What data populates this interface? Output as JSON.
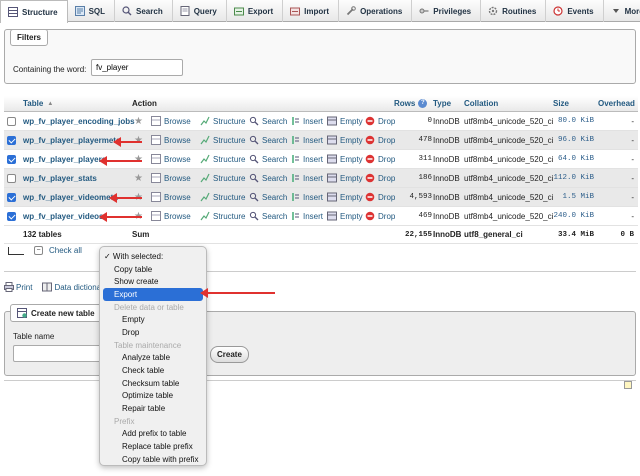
{
  "tabs": [
    {
      "label": "Structure",
      "icon": "structure-icon",
      "active": true
    },
    {
      "label": "SQL",
      "icon": "sql-icon"
    },
    {
      "label": "Search",
      "icon": "search-icon"
    },
    {
      "label": "Query",
      "icon": "query-icon"
    },
    {
      "label": "Export",
      "icon": "export-icon"
    },
    {
      "label": "Import",
      "icon": "import-icon"
    },
    {
      "label": "Operations",
      "icon": "operations-icon"
    },
    {
      "label": "Privileges",
      "icon": "privileges-icon"
    },
    {
      "label": "Routines",
      "icon": "routines-icon"
    },
    {
      "label": "Events",
      "icon": "events-icon"
    },
    {
      "label": "More",
      "icon": "more-icon"
    }
  ],
  "filters": {
    "legend": "Filters",
    "label": "Containing the word:",
    "value": "fv_player"
  },
  "table": {
    "headers": {
      "table": "Table",
      "action": "Action",
      "rows": "Rows",
      "type": "Type",
      "collation": "Collation",
      "size": "Size",
      "overhead": "Overhead"
    },
    "actions": {
      "browse": "Browse",
      "structure": "Structure",
      "search": "Search",
      "insert": "Insert",
      "empty": "Empty",
      "drop": "Drop"
    },
    "rows": [
      {
        "name": "wp_fv_player_encoding_jobs",
        "checked": false,
        "rows": "0",
        "type": "InnoDB",
        "collation": "utf8mb4_unicode_520_ci",
        "size": "80.0 KiB",
        "overhead": "-"
      },
      {
        "name": "wp_fv_player_playermeta",
        "checked": true,
        "rows": "478",
        "type": "InnoDB",
        "collation": "utf8mb4_unicode_520_ci",
        "size": "96.0 KiB",
        "overhead": "-"
      },
      {
        "name": "wp_fv_player_players",
        "checked": true,
        "rows": "311",
        "type": "InnoDB",
        "collation": "utf8mb4_unicode_520_ci",
        "size": "64.0 KiB",
        "overhead": "-"
      },
      {
        "name": "wp_fv_player_stats",
        "checked": false,
        "rows": "186",
        "type": "InnoDB",
        "collation": "utf8mb4_unicode_520_ci",
        "size": "112.0 KiB",
        "overhead": "-"
      },
      {
        "name": "wp_fv_player_videometa",
        "checked": true,
        "rows": "4,593",
        "type": "InnoDB",
        "collation": "utf8mb4_unicode_520_ci",
        "size": "1.5 MiB",
        "overhead": "-"
      },
      {
        "name": "wp_fv_player_videos",
        "checked": true,
        "rows": "469",
        "type": "InnoDB",
        "collation": "utf8mb4_unicode_520_ci",
        "size": "240.0 KiB",
        "overhead": "-"
      }
    ],
    "summary": {
      "name": "132 tables",
      "action": "Sum",
      "rows": "22,155",
      "type": "InnoDB",
      "collation": "utf8_general_ci",
      "size": "33.4 MiB",
      "overhead": "0 B"
    }
  },
  "controls": {
    "check_all": "Check all",
    "print": "Print",
    "data_dictionary": "Data dictionary"
  },
  "create_table": {
    "legend": "Create new table",
    "name_label": "Table name",
    "button": "Create"
  },
  "menu": {
    "selected": "✓ With selected:",
    "items": [
      {
        "label": "Copy table",
        "kind": "top"
      },
      {
        "label": "Show create",
        "kind": "top"
      },
      {
        "label": "Export",
        "kind": "top",
        "highlighted": true
      },
      {
        "label": "Delete data or table",
        "kind": "group"
      },
      {
        "label": "Empty",
        "kind": "sub"
      },
      {
        "label": "Drop",
        "kind": "sub"
      },
      {
        "label": "Table maintenance",
        "kind": "group"
      },
      {
        "label": "Analyze table",
        "kind": "sub"
      },
      {
        "label": "Check table",
        "kind": "sub"
      },
      {
        "label": "Checksum table",
        "kind": "sub"
      },
      {
        "label": "Optimize table",
        "kind": "sub"
      },
      {
        "label": "Repair table",
        "kind": "sub"
      },
      {
        "label": "Prefix",
        "kind": "group"
      },
      {
        "label": "Add prefix to table",
        "kind": "sub"
      },
      {
        "label": "Replace table prefix",
        "kind": "sub"
      },
      {
        "label": "Copy table with prefix",
        "kind": "sub"
      }
    ]
  },
  "colors": {
    "accent": "#2b6fd6",
    "link": "#235a81",
    "annotation_arrow": "#e0312f"
  }
}
